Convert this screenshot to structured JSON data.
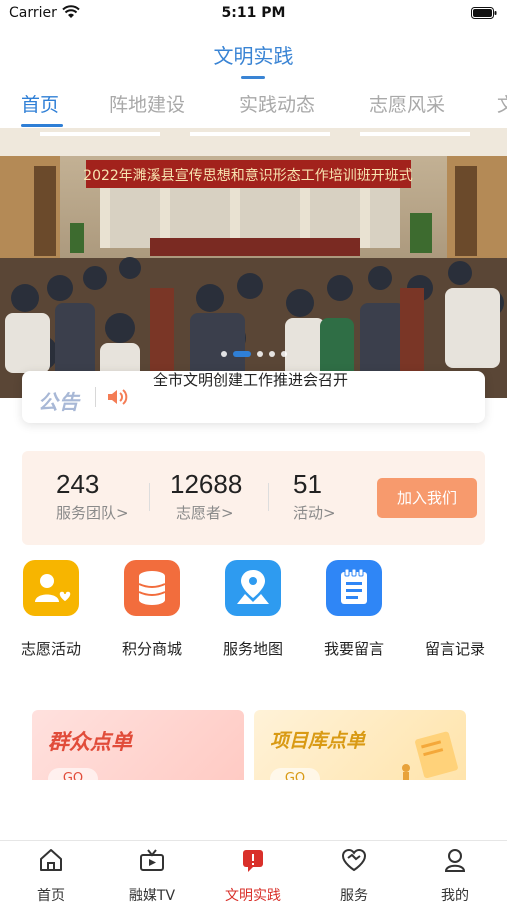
{
  "status_bar": {
    "carrier": "Carrier",
    "time": "5:11 PM"
  },
  "header": {
    "title": "文明实践"
  },
  "tabs": [
    {
      "label": "首页",
      "active": true
    },
    {
      "label": "阵地建设",
      "active": false
    },
    {
      "label": "实践动态",
      "active": false
    },
    {
      "label": "志愿风采",
      "active": false
    },
    {
      "label": "文",
      "active": false
    }
  ],
  "banner": {
    "banner_text": "2022年濉溪县宣传思想和意识形态工作培训班开班式",
    "dots": 5,
    "active_dot": 1
  },
  "notice": {
    "label": "公告",
    "text": "全市文明创建工作推进会召开"
  },
  "stats": {
    "items": [
      {
        "value": "243",
        "label": "服务团队>"
      },
      {
        "value": "12688",
        "label": "志愿者>"
      },
      {
        "value": "51",
        "label": "活动>"
      }
    ],
    "join_label": "加入我们"
  },
  "quick_links": [
    {
      "label": "志愿活动",
      "icon": "volunteer-icon",
      "color": "#f7b500"
    },
    {
      "label": "积分商城",
      "icon": "coins-icon",
      "color": "#f26d3d"
    },
    {
      "label": "服务地图",
      "icon": "map-icon",
      "color": "#2e9bf0"
    },
    {
      "label": "我要留言",
      "icon": "notepad-icon",
      "color": "#2f86f6"
    },
    {
      "label": "留言记录",
      "icon": "",
      "color": ""
    }
  ],
  "cards": [
    {
      "title": "群众点单",
      "go": "GO"
    },
    {
      "title": "项目库点单",
      "go": "GO"
    }
  ],
  "tab_bar": [
    {
      "label": "首页",
      "icon": "home-icon",
      "active": false
    },
    {
      "label": "融媒TV",
      "icon": "tv-icon",
      "active": false
    },
    {
      "label": "文明实践",
      "icon": "practice-icon",
      "active": true
    },
    {
      "label": "服务",
      "icon": "service-heart-icon",
      "active": false
    },
    {
      "label": "我的",
      "icon": "profile-icon",
      "active": false
    }
  ],
  "colors": {
    "accent": "#2f7fd6",
    "stats_bg": "#fdf1ea",
    "join_button": "#f79a6d",
    "tab_active": "#d9302a"
  }
}
